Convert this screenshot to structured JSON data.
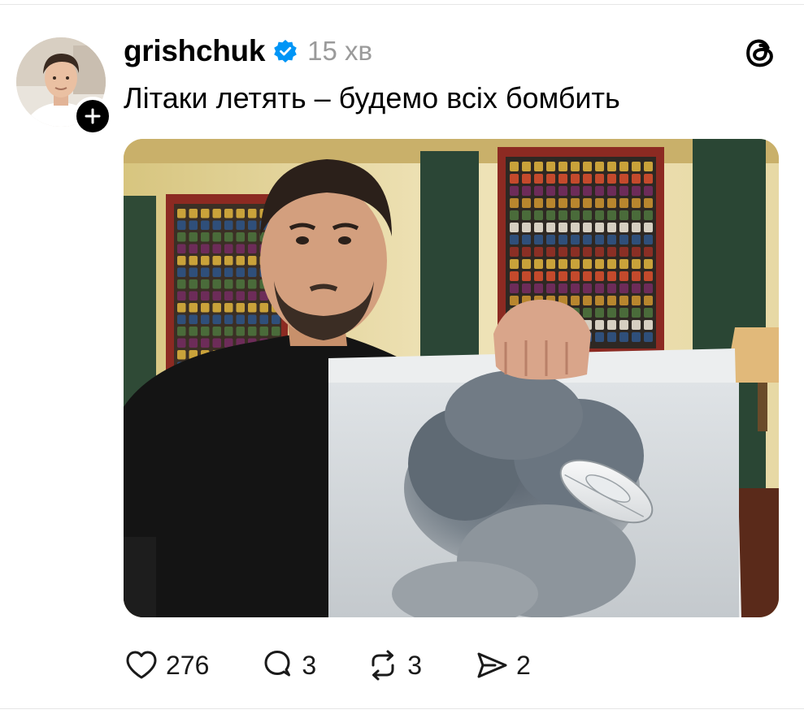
{
  "post": {
    "username": "grishchuk",
    "timestamp": "15 хв",
    "text": "Літаки летять – будемо всіх бомбить",
    "verified": true
  },
  "stats": {
    "likes": "276",
    "replies": "3",
    "reposts": "3",
    "shares": "2"
  },
  "colors": {
    "verified_badge": "#0095f6",
    "text": "#000000",
    "muted": "#9a9a9a",
    "divider": "#e6e6e6"
  },
  "icons": {
    "like": "heart-icon",
    "reply": "comment-icon",
    "repost": "repost-icon",
    "share": "send-icon",
    "app": "threads-logo-icon",
    "follow": "plus-icon"
  }
}
